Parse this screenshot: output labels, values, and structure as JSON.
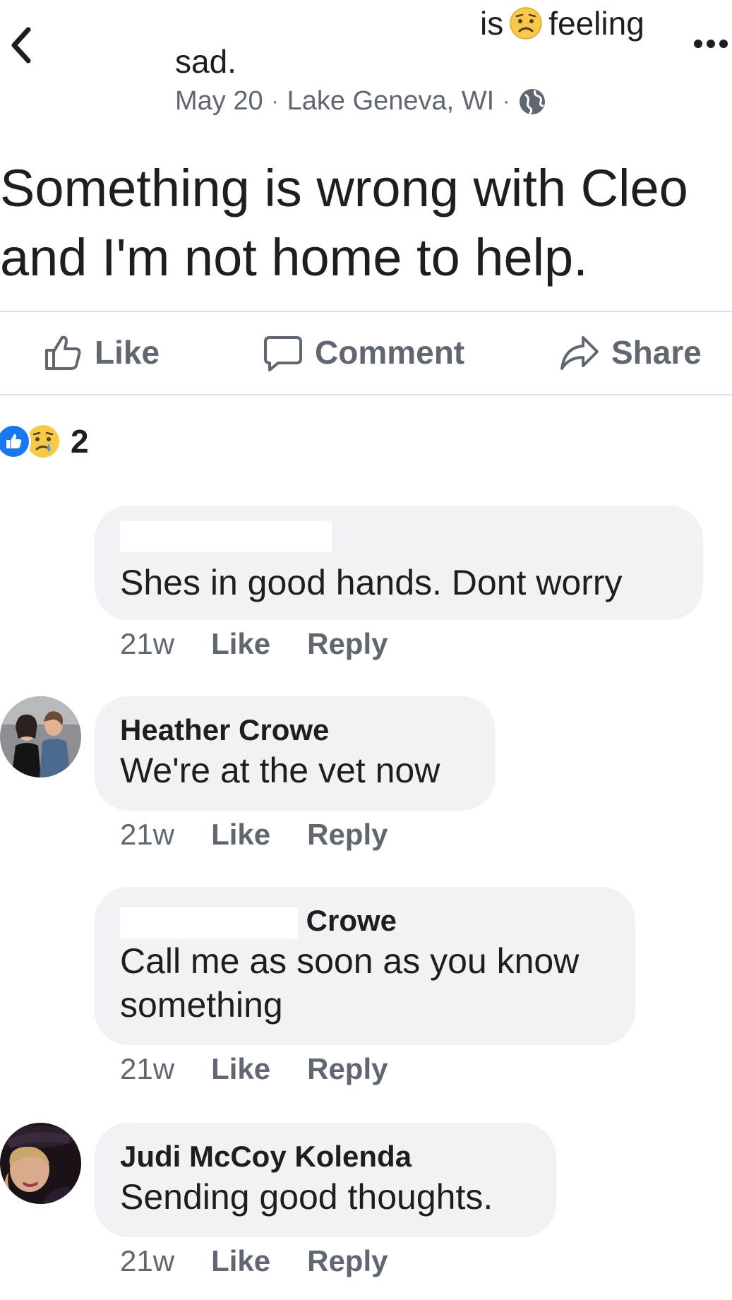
{
  "header": {
    "status_is": "is",
    "status_feeling": "feeling",
    "status_mood": "sad.",
    "date": "May 20",
    "location": "Lake Geneva, WI",
    "separator": "·"
  },
  "post": {
    "text": "Something is wrong with Cleo and I'm not home to help."
  },
  "actions": {
    "like": "Like",
    "comment": "Comment",
    "share": "Share"
  },
  "reactions": {
    "count": "2"
  },
  "comments": [
    {
      "name": "",
      "text": "Shes in good hands.  Dont worry",
      "time": "21w",
      "like": "Like",
      "reply": "Reply"
    },
    {
      "name": "Heather Crowe",
      "text": "We're at the vet now",
      "time": "21w",
      "like": "Like",
      "reply": "Reply"
    },
    {
      "name": "Crowe",
      "text": "Call me as soon as you know something",
      "time": "21w",
      "like": "Like",
      "reply": "Reply"
    },
    {
      "name": "Judi McCoy Kolenda",
      "text": "Sending good thoughts.",
      "time": "21w",
      "like": "Like",
      "reply": "Reply"
    }
  ],
  "colors": {
    "accent": "#1877f2",
    "secondary_text": "#606770",
    "bubble": "#f0f2f5"
  }
}
